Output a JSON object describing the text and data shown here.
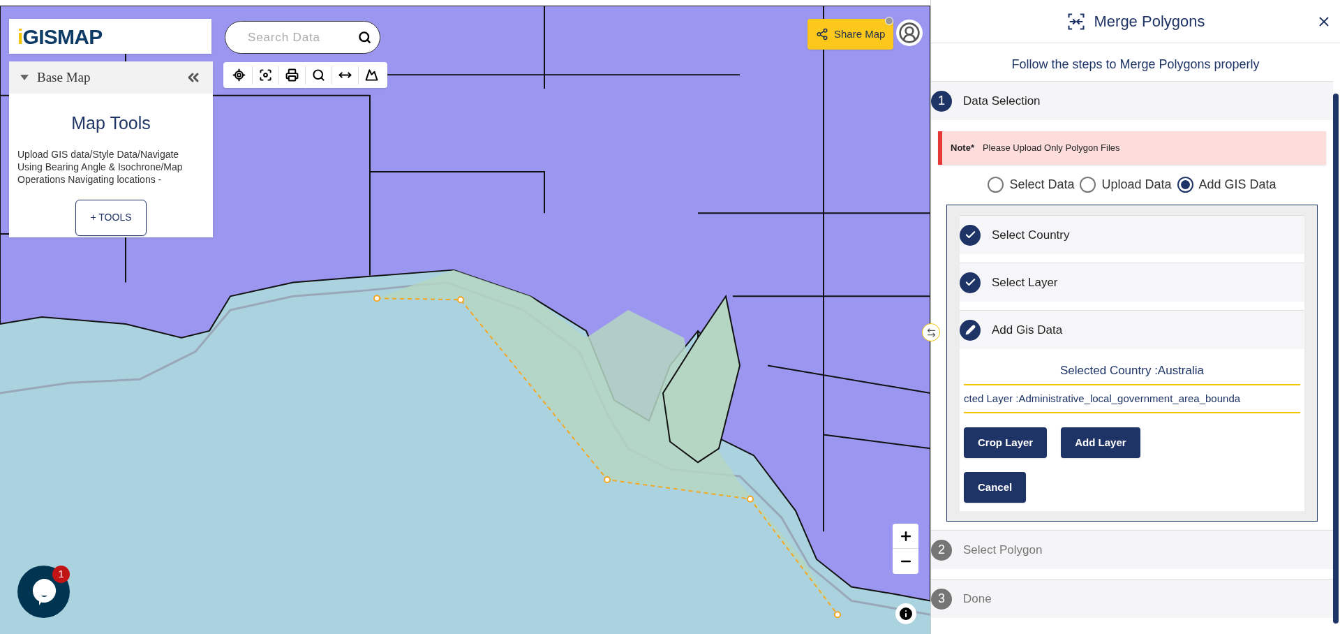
{
  "logo": {
    "text": "iGISMAP"
  },
  "base_map": {
    "label": "Base Map",
    "expanded": true
  },
  "map_tools": {
    "title": "Map Tools",
    "description": "Upload GIS data/Style Data/Navigate Using Bearing Angle & Isochrone/Map Operations Navigating locations -",
    "button": "+ TOOLS"
  },
  "search": {
    "placeholder": "Search Data"
  },
  "share_button": {
    "label": "Share Map"
  },
  "chat": {
    "badge": "1"
  },
  "panel": {
    "title": "Merge Polygons",
    "subtitle": "Follow the steps to Merge Polygons properly",
    "steps": [
      {
        "number": "1",
        "label": "Data Selection",
        "active": true
      },
      {
        "number": "2",
        "label": "Select Polygon",
        "active": false
      },
      {
        "number": "3",
        "label": "Done",
        "active": false
      }
    ],
    "note": {
      "label": "Note*",
      "text": "Please Upload Only Polygon Files"
    },
    "radios": [
      {
        "label": "Select Data",
        "selected": false
      },
      {
        "label": "Upload Data",
        "selected": false
      },
      {
        "label": "Add GIS Data",
        "selected": true
      }
    ],
    "substeps": [
      {
        "label": "Select Country",
        "completed": true
      },
      {
        "label": "Select Layer",
        "completed": true
      },
      {
        "label": "Add Gis Data",
        "completed": false
      }
    ],
    "selected_country": "Selected Country :Australia",
    "selected_layer": "cted Layer :Administrative_local_government_area_bounda",
    "buttons": [
      "Crop Layer",
      "Add Layer",
      "Cancel"
    ]
  }
}
